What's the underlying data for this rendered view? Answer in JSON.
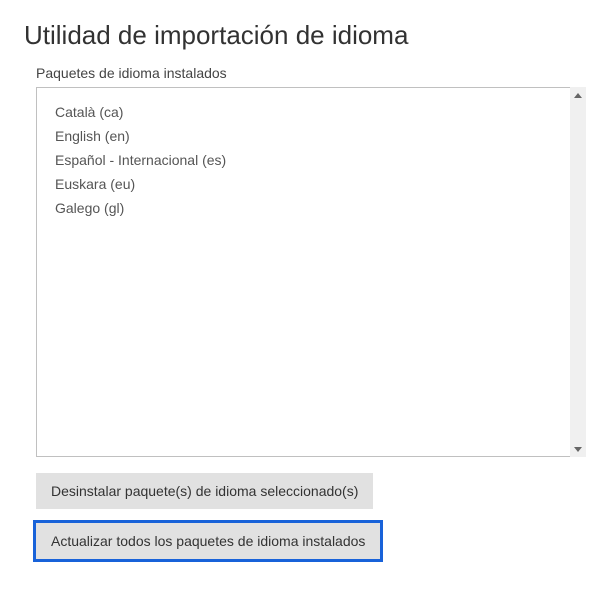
{
  "title": "Utilidad de importación de idioma",
  "list_label": "Paquetes de idioma instalados",
  "languages": [
    "Català (ca)",
    "English (en)",
    "Español - Internacional (es)",
    "Euskara (eu)",
    "Galego (gl)"
  ],
  "buttons": {
    "uninstall": "Desinstalar paquete(s) de idioma seleccionado(s)",
    "update_all": "Actualizar todos los paquetes de idioma instalados"
  }
}
